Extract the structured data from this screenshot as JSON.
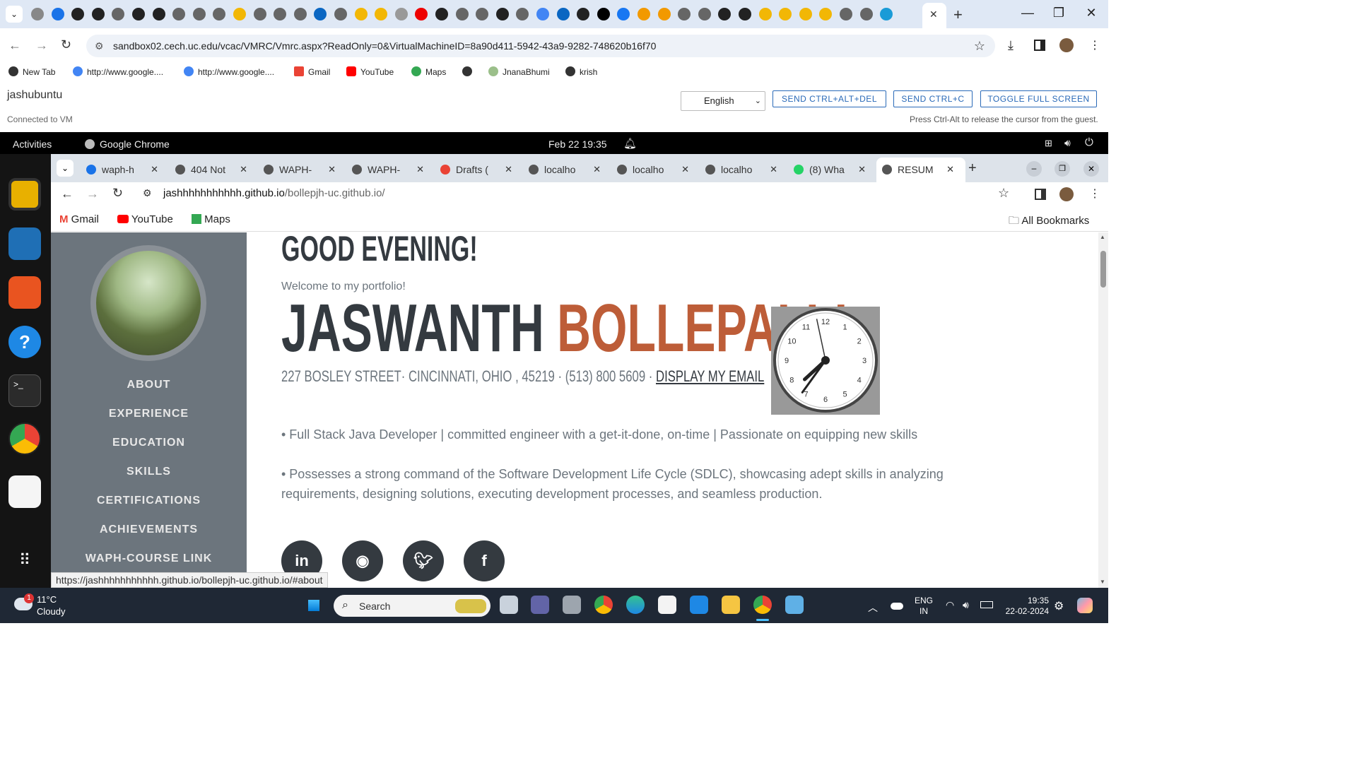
{
  "host_browser": {
    "url": "sandbox02.cech.uc.edu/vcac/VMRC/Vmrc.aspx?ReadOnly=0&VirtualMachineID=8a90d411-5942-43a9-9282-748620b16f70",
    "tab_close": "✕",
    "new_tab": "+",
    "bookmarks": [
      {
        "label": "New Tab"
      },
      {
        "label": "http://www.google...."
      },
      {
        "label": "http://www.google...."
      },
      {
        "label": "Gmail"
      },
      {
        "label": "YouTube"
      },
      {
        "label": "Maps"
      },
      {
        "label": ""
      },
      {
        "label": "JnanaBhumi"
      },
      {
        "label": "krish"
      }
    ]
  },
  "vmrc": {
    "vm_name": "jashubuntu",
    "status": "Connected to VM",
    "language": "English",
    "btn_ctrl_alt_del": "SEND CTRL+ALT+DEL",
    "btn_ctrl_c": "SEND CTRL+C",
    "btn_fullscreen": "TOGGLE FULL SCREEN",
    "hint": "Press Ctrl-Alt to release the cursor from the guest."
  },
  "guest_topbar": {
    "activities": "Activities",
    "app": "Google Chrome",
    "clock": "Feb 22  19:35"
  },
  "guest_browser": {
    "tabs": [
      {
        "label": "waph-h"
      },
      {
        "label": "404 Not"
      },
      {
        "label": "WAPH-"
      },
      {
        "label": "WAPH-"
      },
      {
        "label": "Drafts ("
      },
      {
        "label": "localho"
      },
      {
        "label": "localho"
      },
      {
        "label": "localho"
      },
      {
        "label": "(8) Wha"
      },
      {
        "label": "RESUM"
      }
    ],
    "url_domain": "jashhhhhhhhhhh.github.io",
    "url_path": "/bollepjh-uc.github.io/",
    "bookmarks": [
      "Gmail",
      "YouTube",
      "Maps"
    ],
    "all_bookmarks": "All Bookmarks",
    "status_url": "https://jashhhhhhhhhhh.github.io/bollepjh-uc.github.io/#about"
  },
  "page": {
    "greeting": "GOOD EVENING!",
    "welcome": "Welcome to my portfolio!",
    "first_name": "JASWANTH",
    "last_name": "BOLLEPALLI",
    "address": "227 BOSLEY STREET· CINCINNATI, OHIO , 45219 · (513) 800 5609 · ",
    "email_link": "DISPLAY MY EMAIL",
    "bullet1": "• Full Stack Java Developer | committed engineer with a get-it-done, on-time | Passionate on equipping new skills",
    "bullet2": "• Possesses a strong command of the Software Development Life Cycle (SDLC), showcasing adept skills in analyzing requirements, designing solutions, executing development processes, and seamless production.",
    "nav": [
      "ABOUT",
      "EXPERIENCE",
      "EDUCATION",
      "SKILLS",
      "CERTIFICATIONS",
      "ACHIEVEMENTS",
      "WAPH-COURSE LINK"
    ],
    "clock_numbers": [
      "12",
      "1",
      "2",
      "3",
      "4",
      "5",
      "6",
      "7",
      "8",
      "9",
      "10",
      "11"
    ],
    "clock_time": {
      "hour": 7,
      "minute": 35,
      "second": 58
    },
    "accent_color": "#bd5d38",
    "sidebar_color": "#6c757d"
  },
  "taskbar": {
    "temp": "11°C",
    "weather": "Cloudy",
    "weather_badge": "1",
    "search": "Search",
    "lang1": "ENG",
    "lang2": "IN",
    "time": "19:35",
    "date": "22-02-2024"
  }
}
